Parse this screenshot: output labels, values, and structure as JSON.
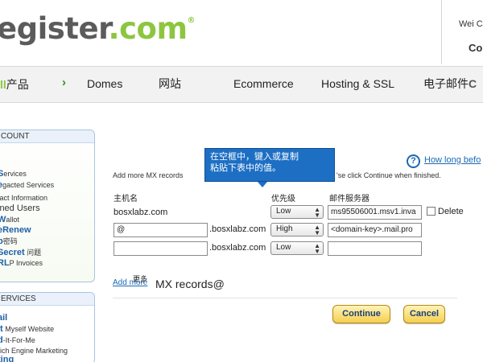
{
  "header": {
    "logo_part1": "egister",
    "logo_part2": ".com",
    "logo_reg": "®",
    "user_greeting": "Wei CO",
    "user_company": "Co"
  },
  "nav": {
    "first_accent": "ll",
    "first_label": "产品",
    "chevron": "›",
    "items": [
      "Domes",
      "网站",
      "Ecommerce",
      "Hosting & SSL",
      "电子邮件"
    ],
    "last_suffix": "C"
  },
  "sidebar": {
    "account_header": "COUNT",
    "account_items": [
      {
        "lead": "",
        "red": "i",
        "text": ""
      },
      {
        "lead": "S",
        "red": "",
        "text": "ervices"
      },
      {
        "lead": "e",
        "red": "",
        "text": "gacted Services"
      },
      {
        "lead": "",
        "red": "",
        "text": "tact Information"
      },
      {
        "lead": "",
        "red": "",
        "text": "ined Users"
      },
      {
        "lead": "W",
        "red": "",
        "text": "allot"
      },
      {
        "lead": "eRenew",
        "red": "",
        "text": ""
      },
      {
        "lead": "p",
        "red": "",
        "text": "密码"
      },
      {
        "lead": "Secret",
        "red": "",
        "text": " 问题"
      },
      {
        "lead": "RL",
        "red": "",
        "text": "P Invoices"
      }
    ],
    "services_header": "ERVICES",
    "services_items": [
      {
        "lead": "ail",
        "text": ""
      },
      {
        "lead": "It",
        "text": " Myself Website"
      },
      {
        "lead": "d",
        "text": "-It-For-Me"
      },
      {
        "lead": "",
        "text": "rich Engine Marketing"
      },
      {
        "lead": "ting",
        "text": ""
      }
    ]
  },
  "content": {
    "help_icon_glyph": "?",
    "help_link": "How long befo",
    "instructions_left": "Add more MX records",
    "instructions_right": "'se click Continue when finished.",
    "tooltip_line1": "在空框中，键入或复制",
    "tooltip_line2": "粘贴下表中的值。",
    "columns": {
      "host": "主机名",
      "priority": "优先级",
      "mail_server": "邮件服务器"
    },
    "rows": [
      {
        "host": "bosxlabz.com",
        "priority": "Low",
        "mail_server": "ms95506001.msv1.inva",
        "delete_label": "Delete"
      },
      {
        "host": "@",
        "domain": ".bosxlabz.com",
        "priority": "High",
        "mail_server": "<domain-key>.mail.pro"
      },
      {
        "host": "",
        "domain": ".bosxlabz.com",
        "priority": "Low",
        "mail_server": ""
      }
    ],
    "add_more_link": "Add more",
    "add_more_cn": "更多",
    "add_more_overlay": "MX records@",
    "continue_button": "Continue",
    "cancel_button": "Cancel"
  }
}
